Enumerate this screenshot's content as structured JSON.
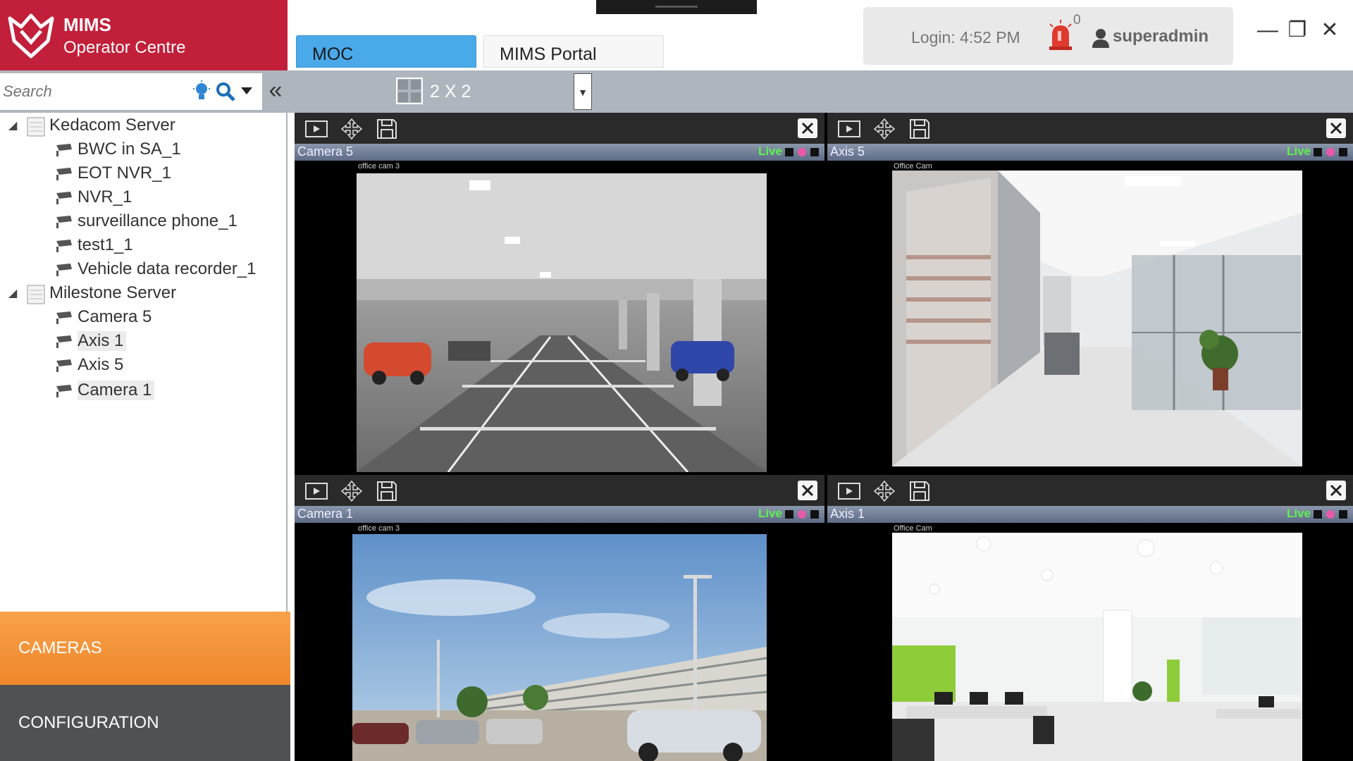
{
  "brand": {
    "name": "MIMS",
    "subtitle": "Operator Centre"
  },
  "tabs": [
    {
      "label": "MOC",
      "active": true
    },
    {
      "label": "MIMS Portal",
      "active": false
    }
  ],
  "session": {
    "login": "Login: 4:52 PM",
    "alarm_count": "0",
    "user": "superadmin"
  },
  "window_controls": {
    "minimize": "—",
    "restore": "❐",
    "close": "✕"
  },
  "search": {
    "placeholder": "Search"
  },
  "collapse_glyph": "«",
  "layout": {
    "label": "2 X 2"
  },
  "tree": {
    "servers": [
      {
        "name": "Kedacom Server",
        "expanded": true,
        "cameras": [
          "BWC in SA_1",
          "EOT NVR_1",
          "NVR_1",
          "surveillance phone_1",
          "test1_1",
          "Vehicle data recorder_1"
        ]
      },
      {
        "name": "Milestone Server",
        "expanded": true,
        "cameras": [
          "Camera 5",
          "Axis 1",
          "Axis 5",
          "Camera 1"
        ],
        "selected": "Axis 1"
      }
    ]
  },
  "nav": {
    "cameras": "CAMERAS",
    "configuration": "CONFIGURATION"
  },
  "tiles": [
    {
      "name": "Camera 5",
      "status": "Live",
      "osd": "office cam 3",
      "scene": "parking garage (grayscale)"
    },
    {
      "name": "Axis 5",
      "status": "Live",
      "osd": "Office Cam",
      "scene": "office corridor"
    },
    {
      "name": "Camera 1",
      "status": "Live",
      "osd": "office cam 3",
      "scene": "outdoor parking lot"
    },
    {
      "name": "Axis 1",
      "status": "Live",
      "osd": "Office Cam",
      "scene": "open office"
    }
  ],
  "colors": {
    "brand": "#c21f3a",
    "tab_active": "#4aa9e9",
    "nav_active": "#f0862b",
    "nav_inactive": "#4f5154",
    "live": "#5ef24e",
    "active_tile_border": "#5160b9"
  },
  "icons": {
    "logo": "mims-shield-logo",
    "alarm": "alarm-siren-icon",
    "user": "user-icon",
    "search": "search-icon",
    "bulb": "lightbulb-icon",
    "layout": "grid-layout-icon",
    "server": "server-icon",
    "camera": "camera-icon",
    "tile_play": "playback-icon",
    "tile_move": "move-icon",
    "tile_save": "save-icon",
    "tile_close": "close-icon"
  }
}
